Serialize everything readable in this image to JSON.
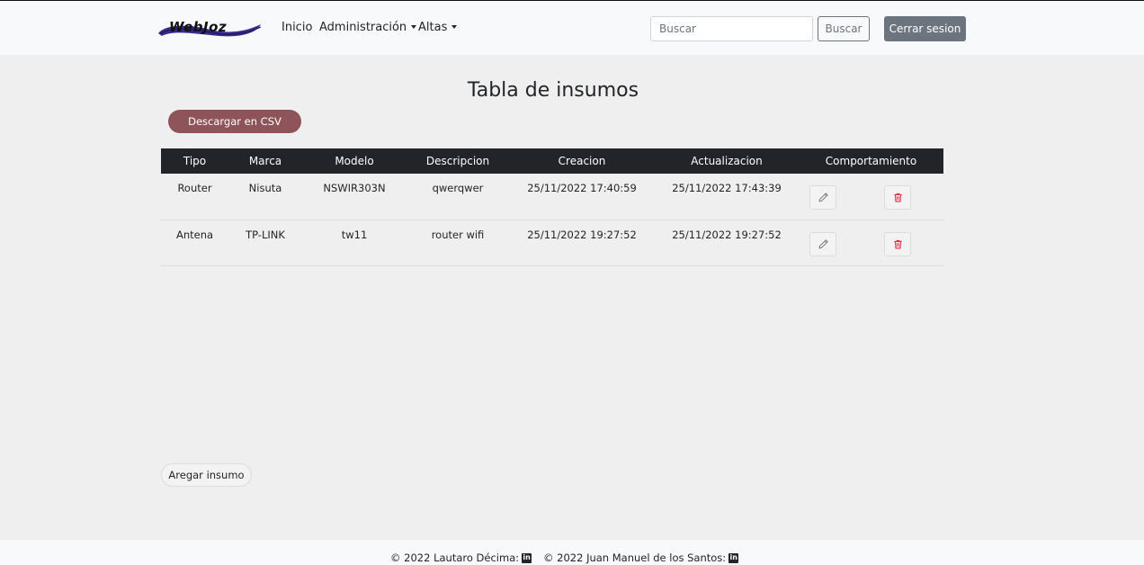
{
  "brand": {
    "logo_text": "WebJoz"
  },
  "nav": {
    "items": [
      {
        "label": "Inicio"
      },
      {
        "label": "Administración"
      },
      {
        "label": "Altas"
      }
    ],
    "search_placeholder": "Buscar",
    "search_label": "Buscar",
    "logout_label": "Cerrar sesion"
  },
  "page": {
    "title": "Tabla de insumos",
    "csv_label": "Descargar en CSV",
    "add_label": "Aregar insumo"
  },
  "table": {
    "headers": [
      "Tipo",
      "Marca",
      "Modelo",
      "Descripcion",
      "Creacion",
      "Actualizacion",
      "Comportamiento"
    ],
    "rows": [
      [
        "Router",
        "Nisuta",
        "NSWIR303N",
        "qwerqwer",
        "25/11/2022 17:40:59",
        "25/11/2022 17:43:39"
      ],
      [
        "Antena",
        "TP-LINK",
        "tw11",
        "router wifi",
        "25/11/2022 19:27:52",
        "25/11/2022 19:27:52"
      ]
    ]
  },
  "footer": {
    "credits": [
      {
        "text": "© 2022 Lautaro Décima:",
        "icon": "linkedin-icon"
      },
      {
        "text": "© 2022 Juan Manuel de los Santos:",
        "icon": "linkedin-icon"
      }
    ]
  },
  "colors": {
    "navbar_bg": "#f8f9fa",
    "page_bg": "#efefef",
    "table_header_bg": "#212529",
    "csv_button": "#8f5459",
    "logout_button": "#6c757d",
    "delete_icon": "#dc3545"
  }
}
